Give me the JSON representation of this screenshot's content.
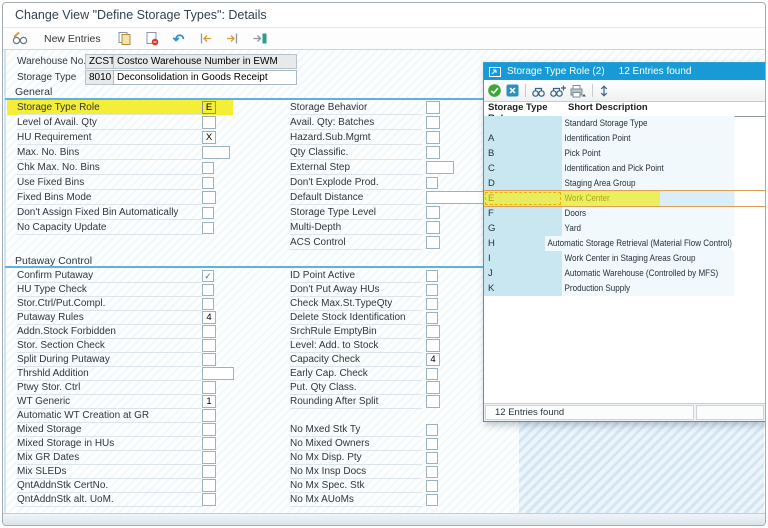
{
  "window": {
    "title": "Change View \"Define Storage Types\": Details"
  },
  "toolbar": {
    "new_entries_label": "New Entries",
    "undo_glyph": "↶",
    "icons": [
      "display-change",
      "copy",
      "delete-row",
      "undo",
      "previous-entry",
      "next-entry",
      "other-entry"
    ]
  },
  "header": {
    "rows": [
      {
        "label": "Warehouse No.",
        "value": "ZCST",
        "desc": "Costco Warehouse Number in EWM"
      },
      {
        "label": "Storage Type",
        "value": "8010",
        "desc": "Deconsolidation in Goods Receipt"
      }
    ]
  },
  "general": {
    "title": "General",
    "left": [
      {
        "label": "Storage Type Role",
        "value": "E"
      },
      {
        "label": "Level of Avail. Qty",
        "value": ""
      },
      {
        "label": "HU Requirement",
        "value": "X"
      },
      {
        "label": "Max. No. Bins",
        "value": ""
      },
      {
        "label": "Chk Max. No. Bins",
        "value": ""
      },
      {
        "label": "Use Fixed Bins",
        "value": ""
      },
      {
        "label": "Fixed Bins Mode",
        "value": ""
      },
      {
        "label": "Don't Assign Fixed Bin Automatically",
        "value": ""
      },
      {
        "label": "No Capacity Update",
        "value": ""
      }
    ],
    "right": [
      {
        "label": "Storage Behavior",
        "value": ""
      },
      {
        "label": "Avail. Qty: Batches",
        "value": ""
      },
      {
        "label": "Hazard.Sub.Mgmt",
        "value": ""
      },
      {
        "label": "Qty Classific.",
        "value": ""
      },
      {
        "label": "External Step",
        "value": ""
      },
      {
        "label": "Don't Explode Prod.",
        "value": ""
      },
      {
        "label": "Default Distance",
        "value": ""
      },
      {
        "label": "Storage Type Level",
        "value": ""
      },
      {
        "label": "Multi-Depth",
        "value": ""
      },
      {
        "label": "ACS Control",
        "value": ""
      }
    ]
  },
  "putaway": {
    "title": "Putaway Control",
    "left": [
      {
        "label": "Confirm Putaway",
        "value": "✓"
      },
      {
        "label": "HU Type Check",
        "value": ""
      },
      {
        "label": "Stor.Ctrl/Put.Compl.",
        "value": ""
      },
      {
        "label": "Putaway Rules",
        "value": "4"
      },
      {
        "label": "Addn.Stock Forbidden",
        "value": ""
      },
      {
        "label": "Stor. Section Check",
        "value": ""
      },
      {
        "label": "Split During Putaway",
        "value": ""
      },
      {
        "label": "Thrshld Addition",
        "value": ""
      },
      {
        "label": "Ptwy Stor. Ctrl",
        "value": ""
      },
      {
        "label": "WT Generic",
        "value": "1"
      },
      {
        "label": "Automatic WT Creation at GR",
        "value": ""
      },
      {
        "label": "Mixed Storage",
        "value": ""
      },
      {
        "label": "Mixed Storage in HUs",
        "value": ""
      },
      {
        "label": "Mix GR Dates",
        "value": ""
      },
      {
        "label": "Mix SLEDs",
        "value": ""
      },
      {
        "label": "QntAddnStk CertNo.",
        "value": ""
      },
      {
        "label": "QntAddnStk alt. UoM.",
        "value": ""
      }
    ],
    "right": [
      {
        "label": "ID Point Active",
        "value": ""
      },
      {
        "label": "Don't Put Away HUs",
        "value": ""
      },
      {
        "label": "Check Max.St.TypeQty",
        "value": ""
      },
      {
        "label": "Delete Stock Identification",
        "value": ""
      },
      {
        "label": "SrchRule EmptyBin",
        "value": ""
      },
      {
        "label": "Level: Add. to Stock",
        "value": ""
      },
      {
        "label": "Capacity Check",
        "value": "4"
      },
      {
        "label": "Early Cap. Check",
        "value": ""
      },
      {
        "label": "Put. Qty Class.",
        "value": ""
      },
      {
        "label": "Rounding After Split",
        "value": ""
      },
      {
        "label": "",
        "value": ""
      },
      {
        "label": "No Mxed Stk Ty",
        "value": ""
      },
      {
        "label": "No Mixed Owners",
        "value": ""
      },
      {
        "label": "No Mx Disp. Pty",
        "value": ""
      },
      {
        "label": "No Mx Insp Docs",
        "value": ""
      },
      {
        "label": "No Mx Spec. Stk",
        "value": ""
      },
      {
        "label": "No Mx AUoMs",
        "value": ""
      }
    ]
  },
  "popup": {
    "title": "Storage Type Role (2)",
    "found": "12 Entries found",
    "columns": [
      "Storage Type Role",
      "Short Description"
    ],
    "icons": [
      "continue",
      "cancel",
      "find",
      "find-next",
      "print",
      "sort"
    ],
    "rows": [
      {
        "role": "",
        "desc": "Standard Storage Type"
      },
      {
        "role": "A",
        "desc": "Identification Point"
      },
      {
        "role": "B",
        "desc": "Pick Point"
      },
      {
        "role": "C",
        "desc": "Identification and Pick Point"
      },
      {
        "role": "D",
        "desc": "Staging Area Group"
      },
      {
        "role": "E",
        "desc": "Work Center"
      },
      {
        "role": "F",
        "desc": "Doors"
      },
      {
        "role": "G",
        "desc": "Yard"
      },
      {
        "role": "H",
        "desc": "Automatic Storage Retrieval (Material Flow Control)"
      },
      {
        "role": "I",
        "desc": "Work Center in Staging Areas Group"
      },
      {
        "role": "J",
        "desc": "Automatic Warehouse (Controlled by MFS)"
      },
      {
        "role": "K",
        "desc": "Production Supply"
      }
    ],
    "status": "12 Entries found"
  },
  "colors": {
    "popup_titlebar": "#189ad6",
    "highlight_yellow": "#f3ea0b",
    "selected_row_border": "#dd9e56",
    "role_column_bg": "#c9e7f1",
    "section_rule_blue": "#5fb2de"
  }
}
